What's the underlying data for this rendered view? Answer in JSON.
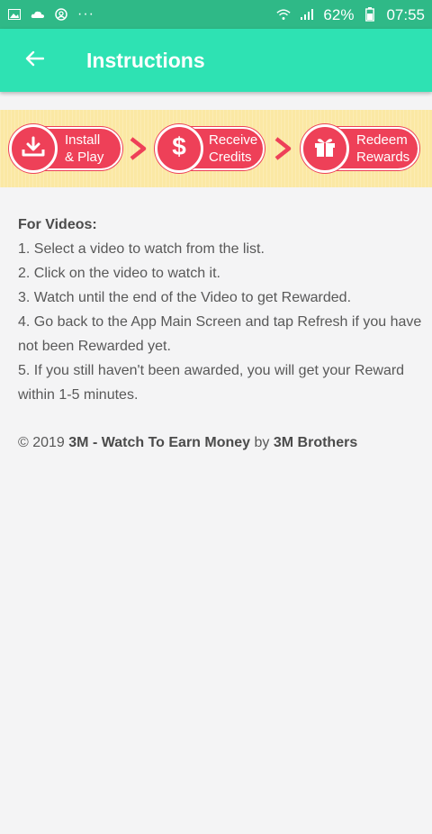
{
  "status_bar": {
    "battery": "62%",
    "time": "07:55",
    "dots": "···",
    "icons": [
      "image-icon",
      "cloud-icon",
      "at-icon",
      "wifi-icon",
      "signal-icon",
      "battery-icon"
    ]
  },
  "app_bar": {
    "title": "Instructions",
    "back_icon": "arrow-left-icon"
  },
  "banner": {
    "steps": [
      {
        "line1": "Install",
        "line2": "& Play",
        "icon": "download-icon"
      },
      {
        "line1": "Receive",
        "line2": "Credits",
        "icon": "dollar-icon"
      },
      {
        "line1": "Redeem",
        "line2": "Rewards",
        "icon": "gift-icon"
      }
    ],
    "accent": "#ee4058",
    "background": "#fbe8a4"
  },
  "instructions": {
    "heading": "For Videos:",
    "steps": [
      "1. Select a video to watch from the list.",
      "2. Click on the video to watch it.",
      "3. Watch until the end of the Video to get Rewarded.",
      "4. Go back to the App Main Screen and tap Refresh if you have not been Rewarded yet.",
      "5. If you still haven't been awarded, you will get your Reward within 1-5 minutes."
    ]
  },
  "footer": {
    "prefix": "© 2019 ",
    "app_name": "3M - Watch To Earn Money",
    "by": " by ",
    "developer": "3M Brothers"
  },
  "colors": {
    "status_bar": "#2fb987",
    "app_bar": "#2ee2b3",
    "page_bg": "#f4f4f5",
    "text": "#585858"
  }
}
